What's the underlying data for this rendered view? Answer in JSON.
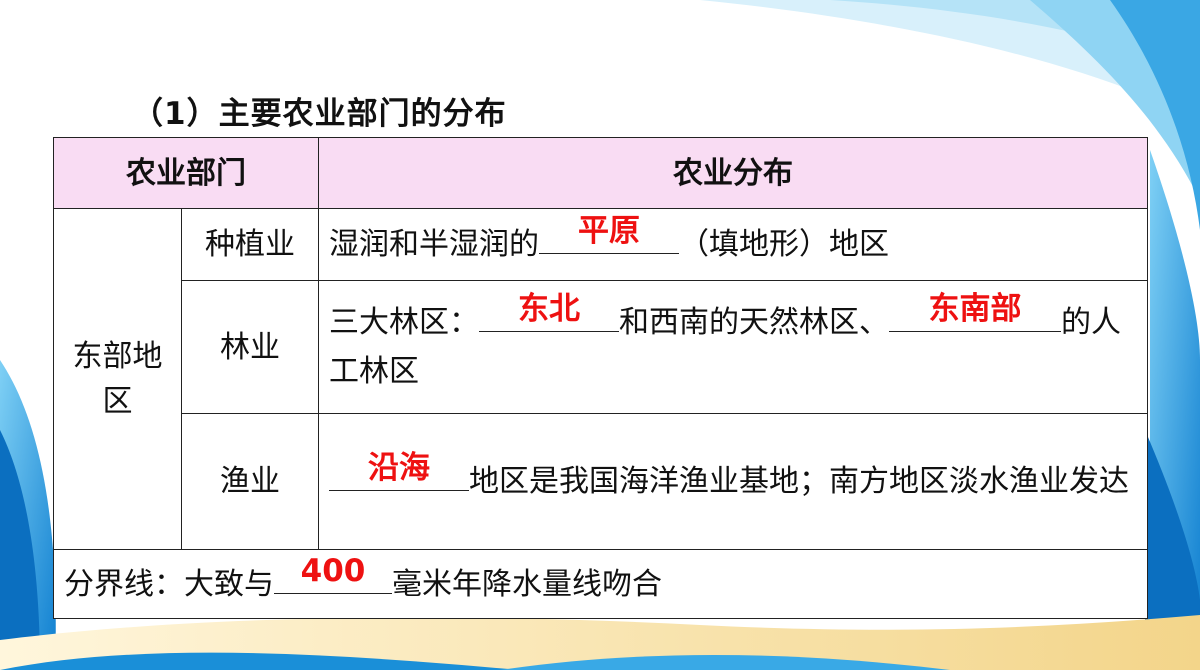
{
  "title": "（1）主要农业部门的分布",
  "table": {
    "header": {
      "col_dept": "农业部门",
      "col_dist": "农业分布"
    },
    "region": "东部地区",
    "rows": [
      {
        "sector": "种植业",
        "before": "湿润和半湿润的",
        "answer1": "平原",
        "after": "（填地形）地区"
      },
      {
        "sector": "林业",
        "before": "三大林区：",
        "answer1": "东北",
        "middle": "和西南的天然林区、",
        "answer2": "东南部",
        "after": "的人工林区"
      },
      {
        "sector": "渔业",
        "answer1": "沿海",
        "after": "地区是我国海洋渔业基地；南方地区淡水渔业发达"
      }
    ],
    "boundary": {
      "before": "分界线：大致与",
      "answer": "400",
      "after": "毫米年降水量线吻合"
    }
  },
  "colors": {
    "header_bg": "#f9dcf3",
    "answer": "#ee1111",
    "wave_blue": "#1a8fd8"
  }
}
